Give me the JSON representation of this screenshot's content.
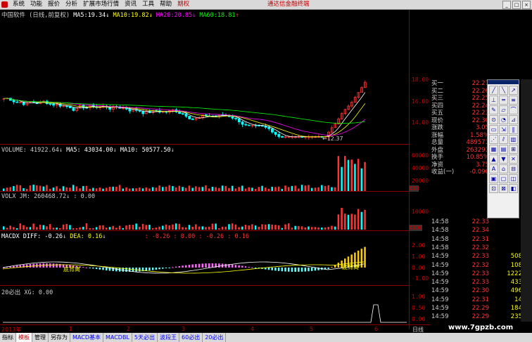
{
  "menu": {
    "items": [
      "系统",
      "功能",
      "报价",
      "分析",
      "扩展市场行情",
      "资讯",
      "工具",
      "帮助",
      "期权"
    ],
    "brand": "通达信金融终端"
  },
  "main_panel": {
    "title": "中国软件 (日线,前复权)",
    "ma5_label": "MA5:",
    "ma5_value": "19.34",
    "ma10_label": "MA10:",
    "ma10_value": "19.82",
    "ma20_label": "MA20:",
    "ma20_value": "20.85",
    "ma60_label": "MA60:",
    "ma60_value": "18.81",
    "low_marker": "12.37",
    "y_ticks": [
      "18.00",
      "16.00",
      "14.00"
    ]
  },
  "volume_panel": {
    "label": "VOLUME: 41922.64",
    "ma5": "MA5: 43034.00",
    "ma10": "MA10: 50577.50",
    "y_ticks": [
      "60000",
      "40000",
      "20000"
    ],
    "unit": "X10"
  },
  "volx_panel": {
    "label": "VOLX JM: 260468.72",
    "extra": ": 0.00",
    "y_ticks": [
      "10000"
    ],
    "unit": "X100"
  },
  "macd_panel": {
    "label": "MACDX DIFF: -0.26",
    "dea": "DEA: 0.16",
    "extra": ": -0.26  : 0.00  : -0.26  : 0.16",
    "y_ticks": [
      "2.00",
      "1.00",
      "0.00",
      "-1.00"
    ],
    "annotations": [
      "底背离",
      "底背离"
    ]
  },
  "zb_panel": {
    "label": "20必出 XG: 0.00",
    "y_ticks": [
      "1.00",
      "0.50",
      "0.00"
    ]
  },
  "x_axis": {
    "labels": [
      "2013年",
      "1",
      "2",
      "3",
      "4",
      "5",
      "6"
    ],
    "right": "日线"
  },
  "quote": {
    "rows": [
      {
        "label": "买一",
        "value": "22.27"
      },
      {
        "label": "买二",
        "value": "22.26"
      },
      {
        "label": "买三",
        "value": "22.25"
      },
      {
        "label": "买四",
        "value": "22.24"
      },
      {
        "label": "买五",
        "value": "22.23"
      },
      {
        "label": "现价",
        "value": "22.30"
      },
      {
        "label": "涨跌",
        "value": "3.05"
      },
      {
        "label": "涨幅",
        "value": "1.58%"
      },
      {
        "label": "总量",
        "value": "489571"
      },
      {
        "label": "外盘",
        "value": "263291"
      },
      {
        "label": "换手",
        "value": "10.85%"
      },
      {
        "label": "净资",
        "value": "3.75"
      },
      {
        "label": "收益(一)",
        "value": "-0.090"
      }
    ],
    "trades": [
      {
        "time": "14:58",
        "price": "22.33",
        "vol": "",
        "bs": ""
      },
      {
        "time": "14:58",
        "price": "22.34",
        "vol": "",
        "bs": ""
      },
      {
        "time": "14:58",
        "price": "22.31",
        "vol": "",
        "bs": ""
      },
      {
        "time": "14:58",
        "price": "22.32",
        "vol": "",
        "bs": ""
      },
      {
        "time": "14:59",
        "price": "22.33",
        "vol": "508",
        "bs": "B"
      },
      {
        "time": "14:59",
        "price": "22.32",
        "vol": "108",
        "bs": "S"
      },
      {
        "time": "14:59",
        "price": "22.33",
        "vol": "1222",
        "bs": "S"
      },
      {
        "time": "14:59",
        "price": "22.33",
        "vol": "433",
        "bs": "B"
      },
      {
        "time": "14:59",
        "price": "22.30",
        "vol": "496",
        "bs": "S"
      },
      {
        "time": "14:59",
        "price": "22.31",
        "vol": "14",
        "bs": "S"
      },
      {
        "time": "14:59",
        "price": "22.29",
        "vol": "184",
        "bs": "B"
      },
      {
        "time": "14:59",
        "price": "22.29",
        "vol": "235",
        "bs": "B"
      }
    ]
  },
  "tabs": [
    "指标",
    "模板",
    "管理",
    "另存为",
    "MACD基本",
    "MACDBL",
    "5天必出",
    "波段王",
    "60必出",
    "20必出"
  ],
  "watermark": "www.7gpzb.com",
  "colors": {
    "up": "#ff3333",
    "down": "#00ffff",
    "ma5": "#ffffff",
    "ma10": "#ffff00",
    "ma20": "#ff00ff",
    "ma60": "#00ff00"
  }
}
